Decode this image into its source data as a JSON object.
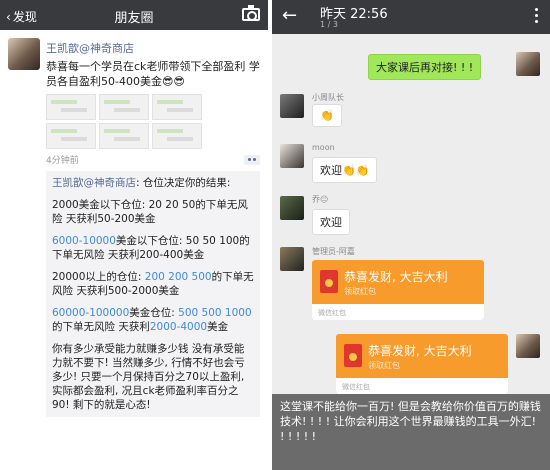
{
  "left": {
    "back_label": "发现",
    "title": "朋友圈",
    "post": {
      "author": "王凯歆@神奇商店",
      "text": "恭喜每一个学员在ck老师带领下全部盈利 学员各自盈利50-400美金😎😎",
      "time": "4分钟前"
    },
    "comment": {
      "author": "王凯歆@神奇商店",
      "intro": "仓位决定你的结果:",
      "lines": [
        {
          "plain": "2000美金以下仓位:  20 20 50的下单无风险 天获利50-200美金",
          "hl": ""
        },
        {
          "plain": "美金以下仓位:  50 50 100的下单无风险 天获利200-400美金",
          "hl": "6000-10000"
        },
        {
          "plain": "20000以上的仓位:",
          "hl": "200 200 500"
        },
        {
          "plain": "美金仓位",
          "hl": "60000-100000"
        }
      ],
      "p1": "2000美金以下仓位:  20 20 50的下单无风险 天获利50-200美金",
      "p2_hl": "6000-10000",
      "p2": "美金以下仓位:  50 50 100的下单无风险 天获利200-400美金",
      "p3a": "20000以上的仓位: ",
      "p3_hl": "200 200 500",
      "p3b": "的下单无风险 天获利500-2000美金",
      "p4_hl": "60000-100000",
      "p4a": "美金仓位: ",
      "p4_hl2": "500 500 1000",
      "p4b": "的下单无风险 天获利",
      "p4_hl3": "2000-4000",
      "p4c": "美金",
      "p5": "你有多少承受能力就赚多少钱 没有承受能力就不要下! 当然赚多少, 行情不好也会亏多少! 只要一个月保持百分之70以上盈利, 实际都会盈利, 况且ck老师盈利率百分之90! 剩下的就是心态!"
    }
  },
  "right": {
    "time": "昨天 22:56",
    "page": "1 / 3",
    "messages": {
      "m1": "大家课后再对接! ! !",
      "s2": "小周队长",
      "m2": "👏",
      "s3": "moon",
      "m3": "欢迎👏👏",
      "s4": "乔😐",
      "m4": "欢迎",
      "s5": "管理员-阿嘉"
    },
    "redpacket": {
      "title": "恭喜发财, 大吉大利",
      "sub": "领取红包",
      "foot": "微信红包"
    },
    "overlay": {
      "text": "这堂课不能给你一百万! 但是会教给你价值百万的赚钱技术! ! ! ! 让你会利用这个世界最赚钱的工具一外汇! ! ! ! ! !"
    }
  }
}
